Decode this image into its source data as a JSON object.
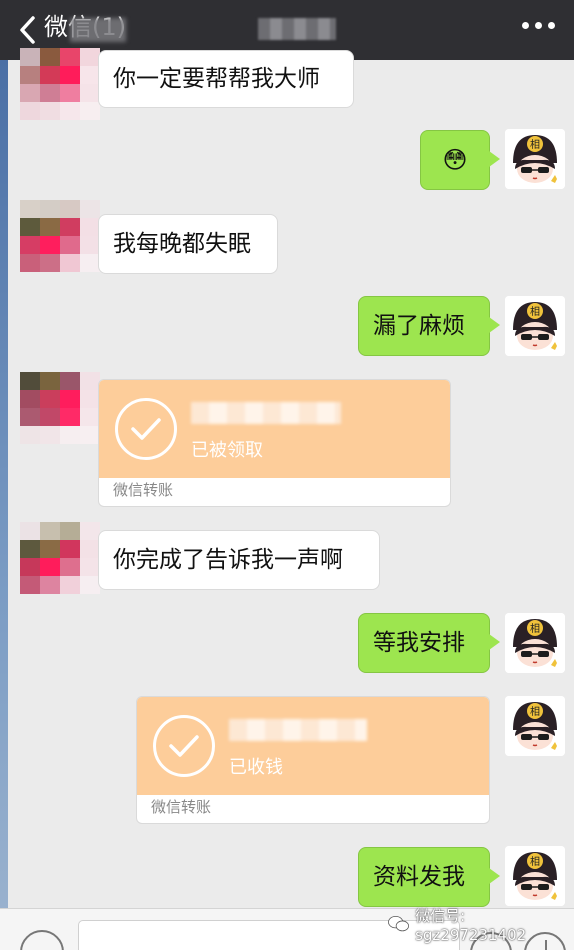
{
  "header": {
    "title": "微信(1)",
    "background": "#2f2f33"
  },
  "messages": [
    {
      "side": "left",
      "type": "text",
      "text": "你一定要帮帮我大师"
    },
    {
      "side": "right",
      "type": "emoji",
      "emoji": "😳"
    },
    {
      "side": "left",
      "type": "text",
      "text": "我每晚都失眠"
    },
    {
      "side": "right",
      "type": "text",
      "text": "漏了麻烦"
    },
    {
      "side": "left",
      "type": "transfer",
      "status": "已被领取",
      "footer": "微信转账"
    },
    {
      "side": "left",
      "type": "text",
      "text": "你完成了告诉我一声啊"
    },
    {
      "side": "right",
      "type": "text",
      "text": "等我安排"
    },
    {
      "side": "right",
      "type": "transfer",
      "status": "已收钱",
      "footer": "微信转账"
    },
    {
      "side": "right",
      "type": "text",
      "text": "资料发我"
    }
  ],
  "avatar_badge": "相",
  "watermark": "微信号: sgz297231402",
  "colors": {
    "chat_background": "#ebebeb",
    "sent_bubble": "#9de54f",
    "received_bubble": "#ffffff",
    "transfer_card": "#fdcd9a"
  },
  "icons": {
    "back": "chevron-left-icon",
    "more": "more-dots-icon",
    "voice": "voice-icon",
    "emoji": "emoji-icon",
    "plus": "plus-icon",
    "check": "check-icon",
    "watermark_logo": "wechat-logo-icon"
  }
}
